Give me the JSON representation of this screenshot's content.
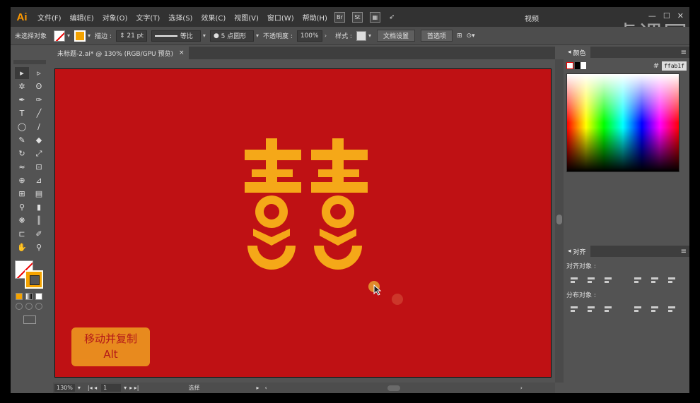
{
  "app": {
    "logo": "Ai",
    "menu": [
      "文件(F)",
      "编辑(E)",
      "对象(O)",
      "文字(T)",
      "选择(S)",
      "效果(C)",
      "视图(V)",
      "窗口(W)",
      "帮助(H)"
    ],
    "bridge_btn": "Br",
    "stock_btn": "St",
    "workspace": "视频",
    "watermark": "虎课网"
  },
  "control_bar": {
    "selection_status": "未选择对象",
    "stroke_label": "描边 :",
    "stroke_value": "21 pt",
    "stroke_profile": "等比",
    "brush": "5 点圆形",
    "opacity_label": "不透明度 :",
    "opacity_value": "100%",
    "style_label": "样式 :",
    "doc_setup": "文档设置",
    "preferences": "首选项"
  },
  "document": {
    "tab_title": "未标题-2.ai* @ 130% (RGB/GPU 预览)",
    "close": "×"
  },
  "canvas": {
    "artboard_color": "#bf1114",
    "symbol_color": "#f5a818",
    "caption_line1": "移动并复制",
    "caption_line2": "Alt"
  },
  "status_bar": {
    "zoom": "130%",
    "page": "1",
    "tool": "选择"
  },
  "color_panel": {
    "title": "颜色",
    "hex_label": "#",
    "hex_value": "ffab1f"
  },
  "align_panel": {
    "title": "对齐",
    "align_objects": "对齐对象 :",
    "distribute_objects": "分布对象 :"
  }
}
